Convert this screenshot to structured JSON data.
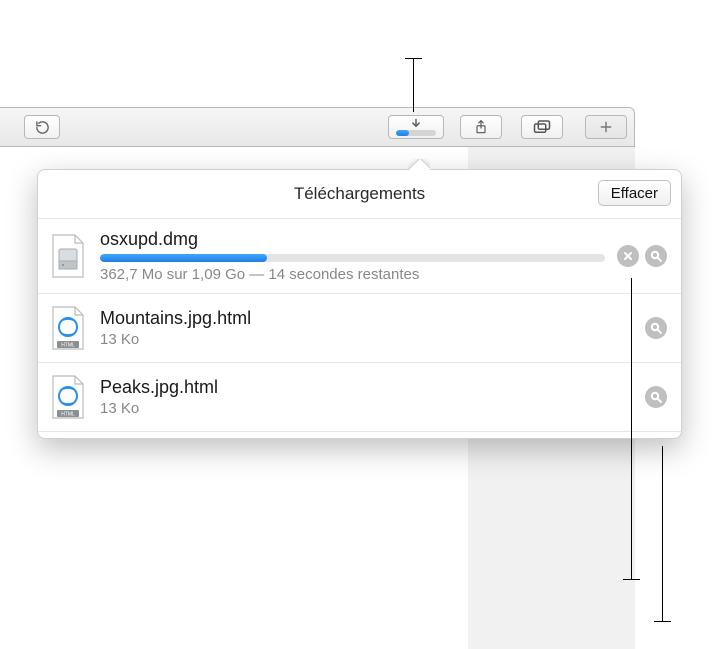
{
  "toolbar": {
    "downloads_progress_percent": 33
  },
  "popover": {
    "title": "Téléchargements",
    "clear_label": "Effacer"
  },
  "downloads": [
    {
      "name": "osxupd.dmg",
      "status": "362,7 Mo sur 1,09 Go — 14 secondes restantes",
      "progress_percent": 33,
      "kind": "dmg",
      "in_progress": true
    },
    {
      "name": "Mountains.jpg.html",
      "status": "13 Ko",
      "kind": "html",
      "in_progress": false
    },
    {
      "name": "Peaks.jpg.html",
      "status": "13 Ko",
      "kind": "html",
      "in_progress": false
    }
  ]
}
